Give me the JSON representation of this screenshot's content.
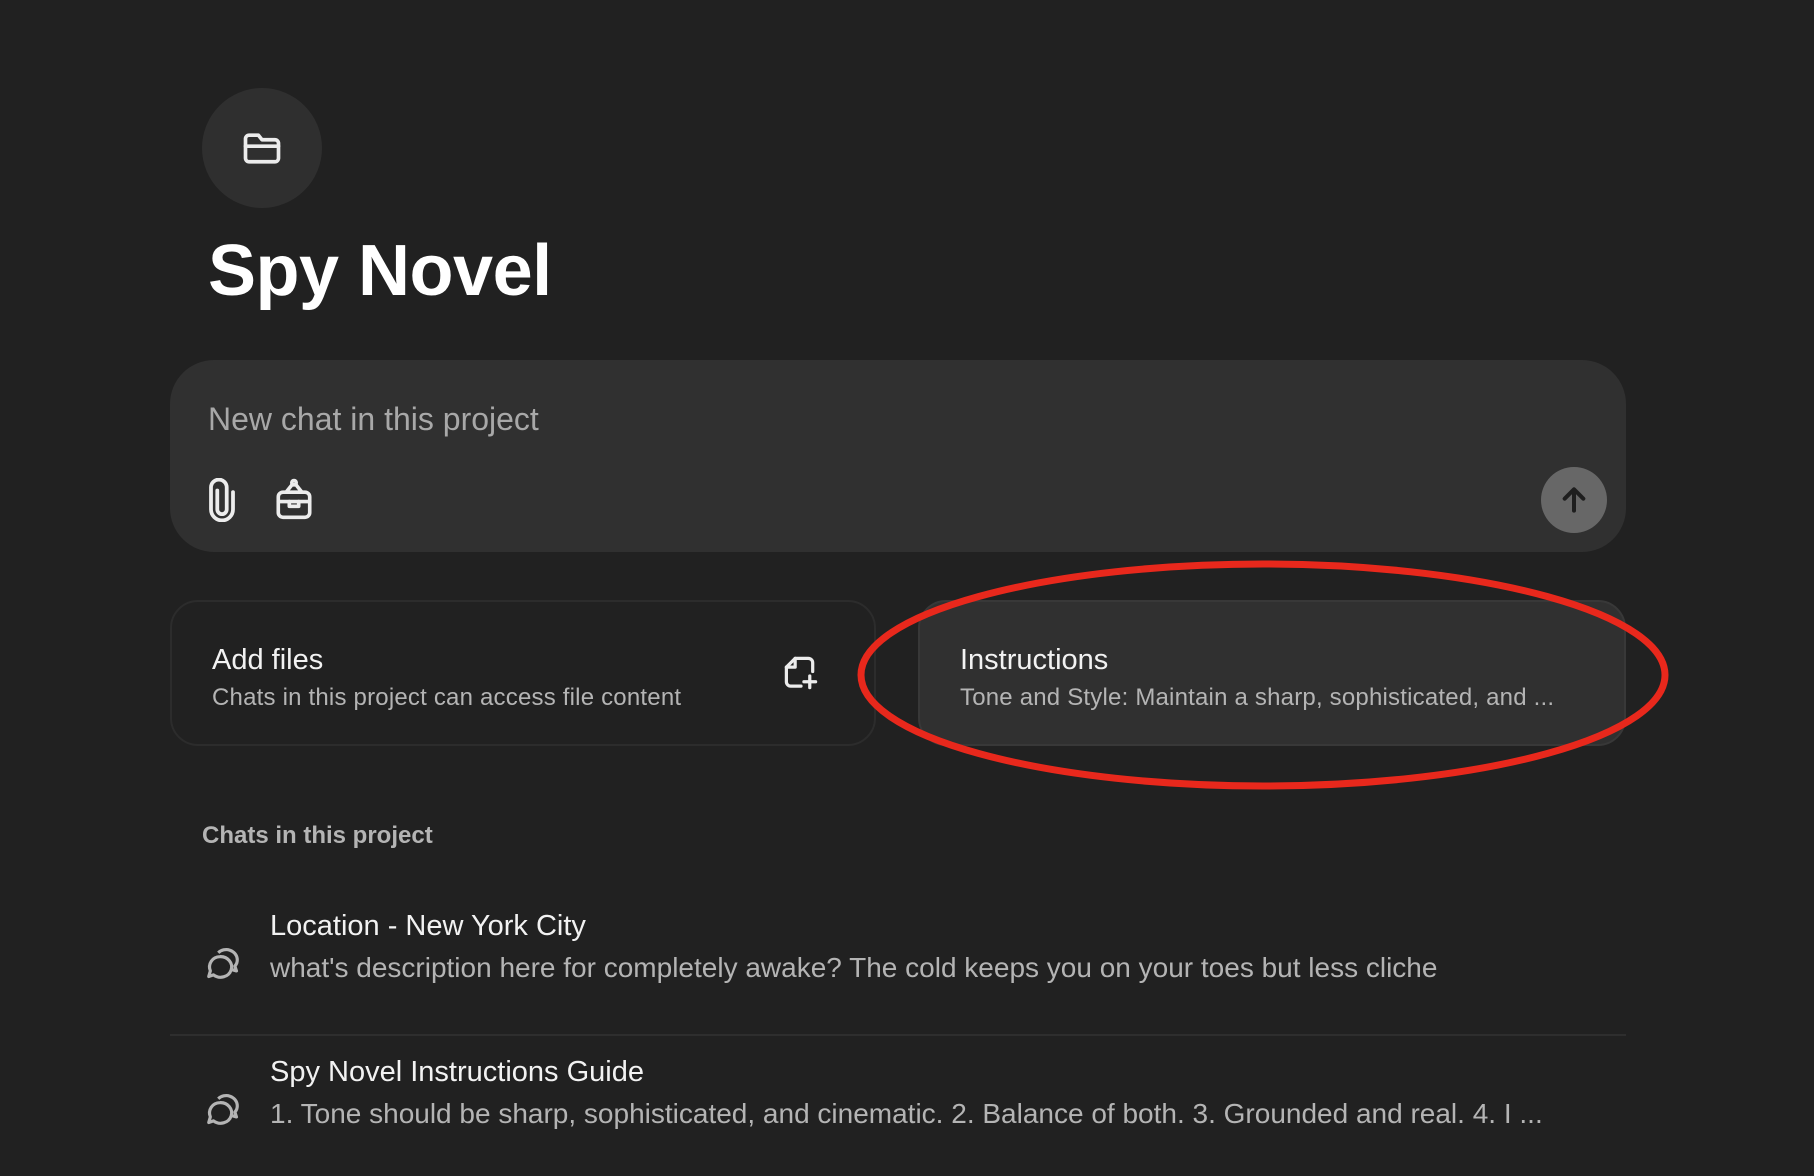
{
  "project": {
    "title": "Spy Novel",
    "icon": "folder-icon"
  },
  "composer": {
    "placeholder": "New chat in this project",
    "value": "",
    "tools": [
      "paperclip-icon",
      "toolbox-icon"
    ],
    "send_icon": "arrow-up-icon"
  },
  "cards": {
    "add_files": {
      "title": "Add files",
      "subtitle": "Chats in this project can access file content",
      "icon": "add-file-icon"
    },
    "instructions": {
      "title": "Instructions",
      "subtitle": "Tone and Style: Maintain a sharp, sophisticated, and ..."
    }
  },
  "annotation": {
    "color": "#e8281c",
    "shape": "ellipse",
    "target": "instructions-card"
  },
  "chats_section": {
    "label": "Chats in this project",
    "items": [
      {
        "title": "Location - New York City",
        "snippet": "what's description here for completely awake? The cold keeps you on your toes but less cliche",
        "icon": "chat-bubbles-icon"
      },
      {
        "title": "Spy Novel Instructions Guide",
        "snippet": "1. Tone should be sharp, sophisticated, and cinematic. 2. Balance of both. 3. Grounded and real. 4. I ...",
        "icon": "chat-bubbles-icon"
      }
    ]
  },
  "colors": {
    "background": "#212121",
    "surface": "#303030",
    "text_primary": "#f2f2f2",
    "text_secondary": "#b4b4b4",
    "send_button": "#676767"
  }
}
